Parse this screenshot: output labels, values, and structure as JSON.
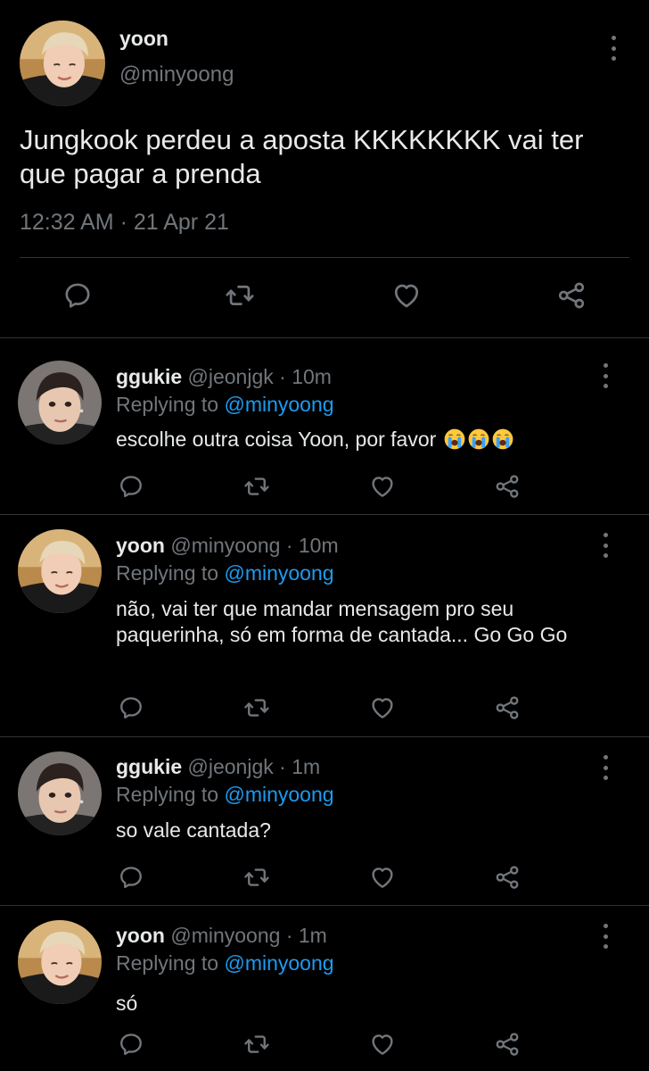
{
  "main_tweet": {
    "name": "yoon",
    "handle": "@minyoong",
    "text": "Jungkook perdeu a aposta KKKKKKKK vai ter que pagar a prenda",
    "timestamp": "12:32 AM · 21 Apr 21",
    "actions": [
      "reply-icon",
      "retweet-icon",
      "like-icon",
      "share-icon"
    ]
  },
  "replies": [
    {
      "name": "ggukie",
      "handle": "@jeonjgk",
      "separator": "·",
      "time": "10m",
      "replying_prefix": "Replying to",
      "replying_to": "@minyoong",
      "text": "escolhe outra coisa Yoon, por favor",
      "emoji": [
        "loudly-crying-face-emoji",
        "loudly-crying-face-emoji",
        "loudly-crying-face-emoji"
      ]
    },
    {
      "name": "yoon",
      "handle": "@minyoong",
      "separator": "·",
      "time": "10m",
      "replying_prefix": "Replying to",
      "replying_to": "@minyoong",
      "text": "não, vai ter que mandar mensagem pro seu paquerinha, só em forma de cantada... Go Go Go"
    },
    {
      "name": "ggukie",
      "handle": "@jeonjgk",
      "separator": "·",
      "time": "1m",
      "replying_prefix": "Replying to",
      "replying_to": "@minyoong",
      "text": "so vale cantada?"
    },
    {
      "name": "yoon",
      "handle": "@minyoong",
      "separator": "·",
      "time": "1m",
      "replying_prefix": "Replying to",
      "replying_to": "@minyoong",
      "text": "só"
    }
  ],
  "colors": {
    "background": "#000000",
    "text": "#e7e9ea",
    "secondary_text": "#71767b",
    "link": "#1d9bf0",
    "divider": "#2f3336"
  }
}
